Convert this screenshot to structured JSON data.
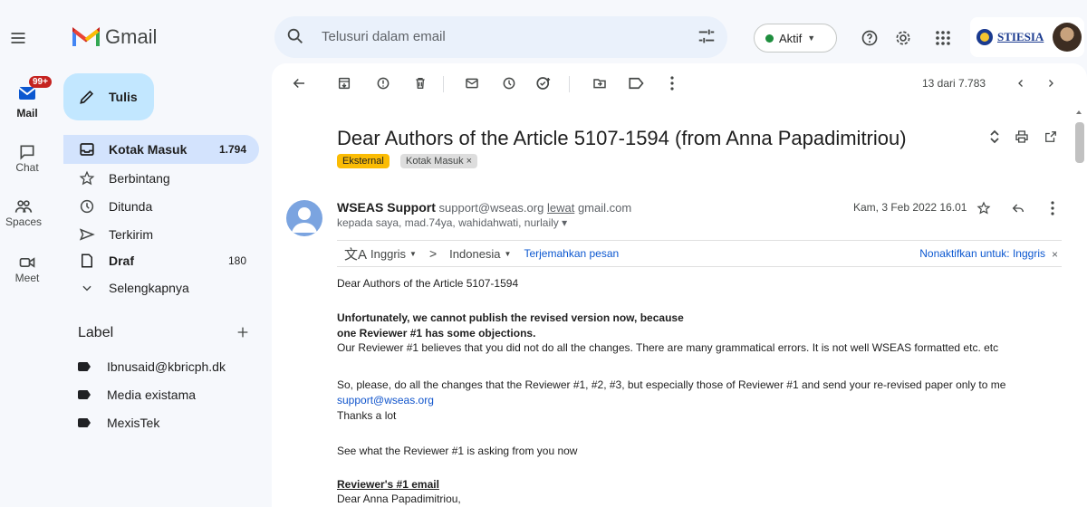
{
  "app": {
    "name": "Gmail"
  },
  "search": {
    "placeholder": "Telusuri dalam email"
  },
  "status": {
    "label": "Aktif"
  },
  "account": {
    "org": "STIESIA"
  },
  "rail": [
    {
      "label": "Mail",
      "badge": "99+"
    },
    {
      "label": "Chat"
    },
    {
      "label": "Spaces"
    },
    {
      "label": "Meet"
    }
  ],
  "compose": {
    "label": "Tulis"
  },
  "nav": [
    {
      "label": "Kotak Masuk",
      "count": "1.794"
    },
    {
      "label": "Berbintang"
    },
    {
      "label": "Ditunda"
    },
    {
      "label": "Terkirim"
    },
    {
      "label": "Draf",
      "count": "180"
    },
    {
      "label": "Selengkapnya"
    }
  ],
  "labels": {
    "title": "Label",
    "items": [
      "Ibnusaid@kbricph.dk",
      "Media existama",
      "MexisTek"
    ]
  },
  "toolbar": {
    "counter": "13 dari 7.783"
  },
  "email": {
    "subject": "Dear Authors of the Article 5107-1594 (from Anna Papadimitriou)",
    "chips": [
      "Eksternal",
      "Kotak Masuk ×"
    ],
    "sender_name": "WSEAS Support",
    "sender_email": "support@wseas.org",
    "via": "lewat",
    "via_domain": "gmail.com",
    "recipients": "kepada saya, mad.74ya, wahidahwati, nurlaily ▾",
    "date": "Kam, 3 Feb 2022 16.01"
  },
  "translate": {
    "from": "Inggris",
    "to": "Indonesia",
    "translate_link": "Terjemahkan pesan",
    "disable": "Nonaktifkan untuk: Inggris",
    "close": "×"
  },
  "body": {
    "greeting": "Dear Authors of the Article  5107-1594",
    "bold1": "Unfortunately, we cannot publish the revised version now, because",
    "bold2": "one  Reviewer #1  has some objections.",
    "p1": "Our Reviewer #1 believes that you did not do all the changes. There are many grammatical errors. It is not well WSEAS formatted etc. etc",
    "p2": "So, please, do all the changes that the Reviewer #1, #2, #3, but especially those of Reviewer #1 and send your re-revised paper only to me",
    "link": "support@wseas.org",
    "thanks": "Thanks a lot",
    "p3": "See what the Reviewer #1 is asking from you now",
    "heading": "Reviewer's #1 email",
    "dear": "Dear Anna Papadimitriou,"
  },
  "colors": {
    "background": "#f6f8fc",
    "active_nav": "#d3e3fd",
    "compose": "#c2e7ff",
    "external_chip": "#fbbc04",
    "link": "#0b57d0",
    "badge": "#c5221f"
  }
}
